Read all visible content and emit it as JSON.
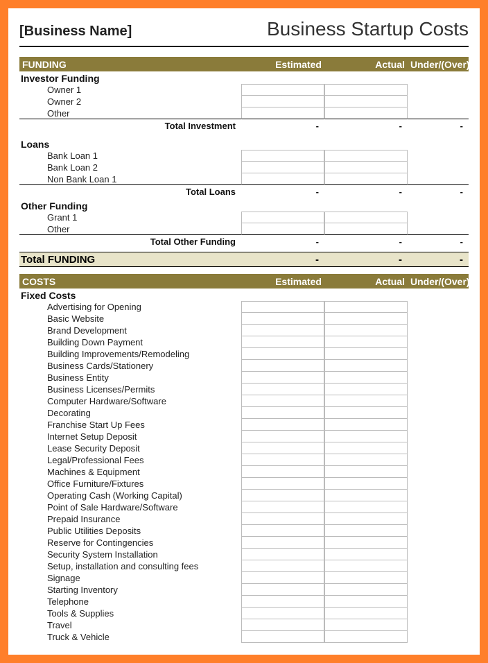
{
  "header": {
    "business_name": "[Business Name]",
    "title": "Business Startup Costs"
  },
  "columns": {
    "estimated": "Estimated",
    "actual": "Actual",
    "under_over": "Under/(Over)"
  },
  "dash": "-",
  "funding": {
    "section_label": "FUNDING",
    "investor": {
      "label": "Investor Funding",
      "items": [
        "Owner 1",
        "Owner 2",
        "Other"
      ],
      "total_label": "Total Investment"
    },
    "loans": {
      "label": "Loans",
      "items": [
        "Bank Loan 1",
        "Bank Loan 2",
        "Non Bank Loan 1"
      ],
      "total_label": "Total Loans"
    },
    "other": {
      "label": "Other Funding",
      "items": [
        "Grant 1",
        "Other"
      ],
      "total_label": "Total Other Funding"
    },
    "grand_total_label": "Total FUNDING"
  },
  "costs": {
    "section_label": "COSTS",
    "fixed": {
      "label": "Fixed Costs",
      "items": [
        "Advertising for Opening",
        "Basic Website",
        "Brand Development",
        "Building Down Payment",
        "Building Improvements/Remodeling",
        "Business Cards/Stationery",
        "Business Entity",
        "Business Licenses/Permits",
        "Computer Hardware/Software",
        "Decorating",
        "Franchise Start Up Fees",
        "Internet Setup Deposit",
        "Lease Security Deposit",
        "Legal/Professional Fees",
        "Machines & Equipment",
        "Office Furniture/Fixtures",
        "Operating Cash (Working Capital)",
        "Point of Sale Hardware/Software",
        "Prepaid Insurance",
        "Public Utilities Deposits",
        "Reserve for Contingencies",
        "Security System Installation",
        "Setup, installation and consulting fees",
        "Signage",
        "Starting Inventory",
        "Telephone",
        "Tools & Supplies",
        "Travel",
        "Truck & Vehicle"
      ]
    }
  }
}
